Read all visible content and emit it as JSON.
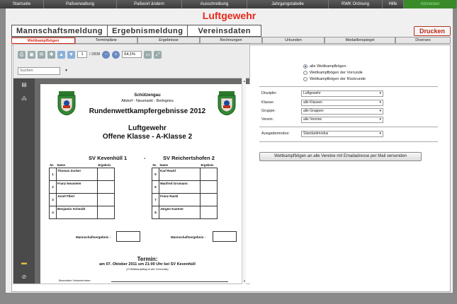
{
  "topnav": {
    "items": [
      {
        "label": "Startseite"
      },
      {
        "label": "Paßverwaltung"
      },
      {
        "label": "Paßwort ändern"
      },
      {
        "label": "Ausschreibung"
      },
      {
        "label": "Jahrgangstabelle"
      },
      {
        "label": "RWK Ordnung"
      },
      {
        "label": "Hilfe"
      },
      {
        "label": "Abmelden"
      }
    ]
  },
  "page": {
    "title": "Luftgewehr"
  },
  "maintabs": [
    {
      "label": "Mannschaftsmeldung"
    },
    {
      "label": "Ergebnismeldung"
    },
    {
      "label": "Vereinsdaten"
    }
  ],
  "print_label": "Drucken",
  "subtabs": [
    {
      "label": "Wettkampfbögen"
    },
    {
      "label": "Terminpläne"
    },
    {
      "label": "Ergebnisse"
    },
    {
      "label": "Rechnungen"
    },
    {
      "label": "Urkunden"
    },
    {
      "label": "Medaillenspiegel"
    },
    {
      "label": "Diverses"
    }
  ],
  "viewer": {
    "page_current": "1",
    "page_total": "/ 2838",
    "zoom": "64,1%",
    "search_placeholder": "Suchen"
  },
  "document": {
    "club_line1": "Schützengau",
    "club_line2": "Altdorf - Neumarkt - Beilngries",
    "headline": "Rundenwettkampfergebnisse 2012",
    "discipline": "Luftgewehr",
    "class_name": "Offene Klasse - A-Klasse 2",
    "team_home": "SV Kevenhüll 1",
    "vs": "-",
    "team_away": "SV Reichertshofen 2",
    "col_nr": "Nr.",
    "col_name": "Name",
    "col_result": "Ergebnis",
    "home_players": [
      {
        "nr": "1",
        "name": "Thomas Zucker"
      },
      {
        "nr": "2",
        "name": "Franz Neumeier"
      },
      {
        "nr": "3",
        "name": "Josef Fßerl"
      },
      {
        "nr": "4",
        "name": "Benjamin Schmidt"
      }
    ],
    "away_players": [
      {
        "nr": "5",
        "name": "Karl Rackl"
      },
      {
        "nr": "6",
        "name": "Manfred Gromann"
      },
      {
        "nr": "7",
        "name": "Franz Rackl"
      },
      {
        "nr": "8",
        "name": "Jürgen Kastner"
      }
    ],
    "team_result_label": "Mannschaftsergebnis :",
    "termin_title": "Termin:",
    "termin_text": "am 07. Oktober 2011 um 21:00 Uhr bei SV Kevenhüll",
    "termin_note": "(2.Wettkampftag in der Vorrunde)",
    "remarks_label": "Besondere Vorkommnisse :"
  },
  "filters": {
    "radio_all": "alle Wettkampfbögen",
    "radio_vorrunde": "Wettkampfbögen der Vorrunde",
    "radio_rueckrunde": "Wettkampfbögen der Rückrunde",
    "disziplin_label": "Disziplin:",
    "disziplin_value": "Luftgewehr",
    "klasse_label": "Klasse:",
    "klasse_value": "alle Klassen",
    "gruppe_label": "Gruppe:",
    "gruppe_value": "alle Gruppen",
    "verein_label": "Verein:",
    "verein_value": "alle Vereine",
    "mode_label": "Ausgabemodus:",
    "mode_value": "Standardmodus",
    "mail_button": "Wettkampfbögen an alle Vereine mit Emailadresse per Mail versenden"
  },
  "colors": {
    "accent": "#d42a1c",
    "active_nav": "#3a8a2a"
  },
  "icons": [
    "print-icon",
    "save-icon",
    "mail-icon",
    "settings-icon",
    "arrow-up-icon",
    "arrow-down-icon",
    "zoom-out-icon",
    "zoom-in-icon",
    "fit-page-icon",
    "fullscreen-icon",
    "pages-icon",
    "bookmarks-icon",
    "comments-icon",
    "attachment-icon"
  ]
}
